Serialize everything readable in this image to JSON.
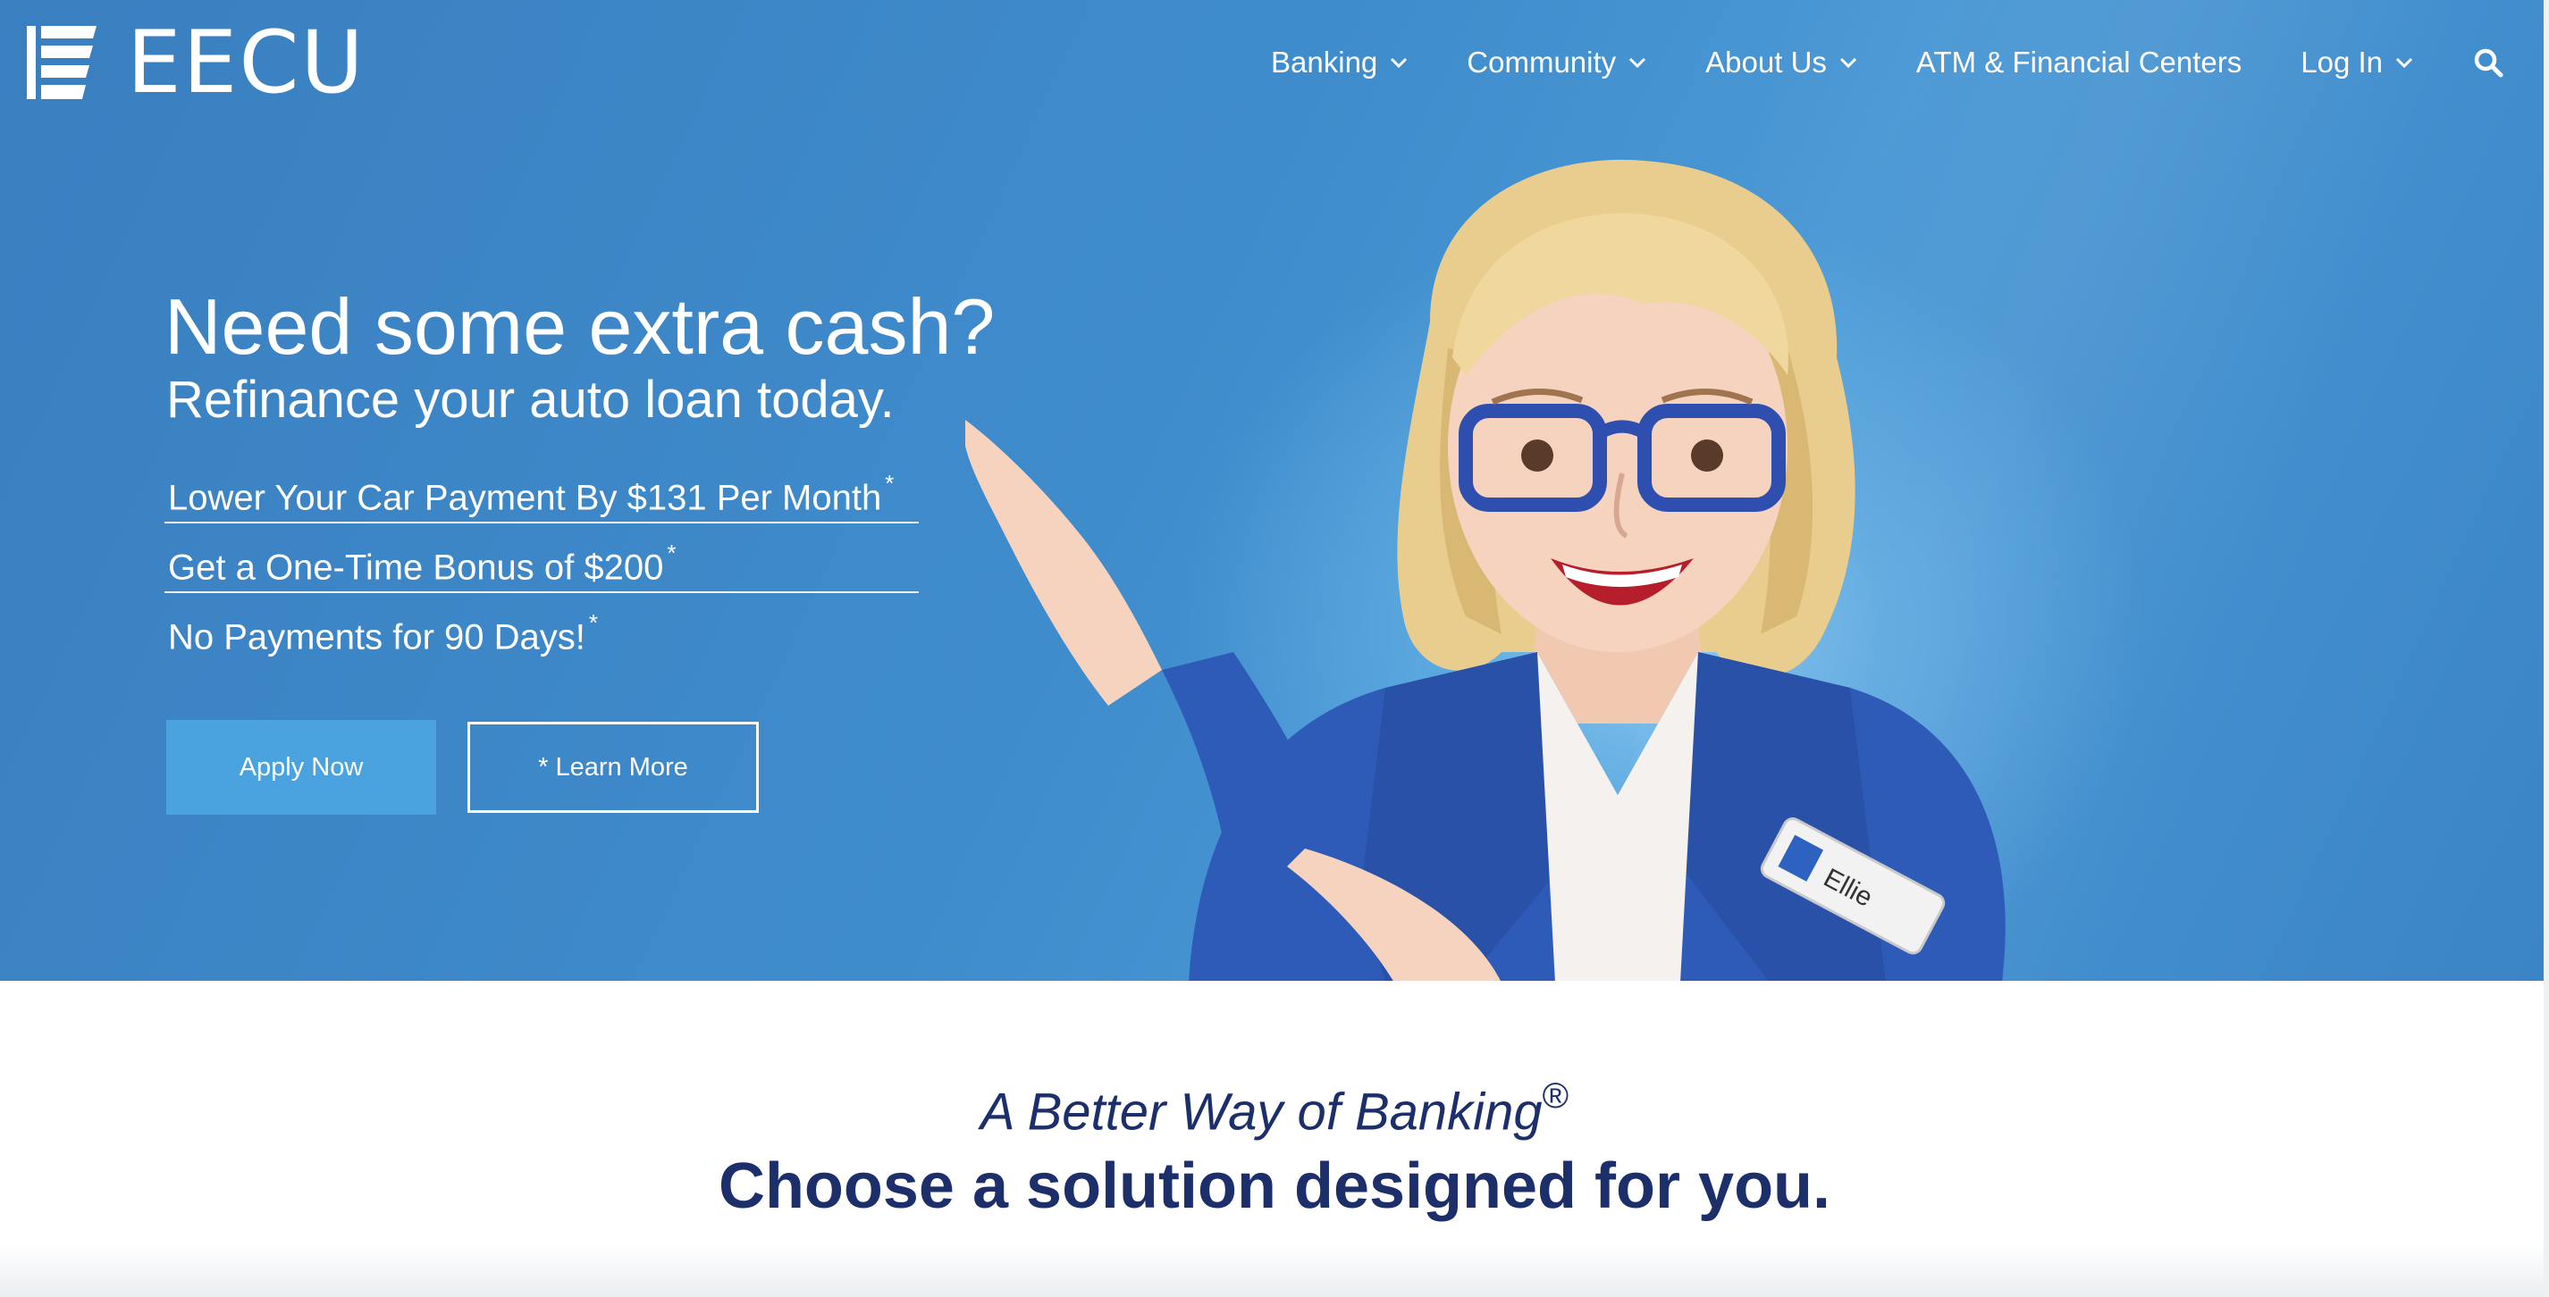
{
  "brand": {
    "name": "EECU",
    "logo_icon": "eecu-logo-mark",
    "primary_blue": "#3f8ccc",
    "navy": "#1d2f6b",
    "button_blue": "#4aa3df"
  },
  "nav": {
    "items": [
      {
        "label": "Banking",
        "has_dropdown": true
      },
      {
        "label": "Community",
        "has_dropdown": true
      },
      {
        "label": "About Us",
        "has_dropdown": true
      },
      {
        "label": "ATM & Financial Centers",
        "has_dropdown": false
      },
      {
        "label": "Log In",
        "has_dropdown": true
      }
    ],
    "search_icon": "search-icon"
  },
  "hero": {
    "headline": "Need some extra cash?",
    "subheadline": "Refinance your auto loan today.",
    "benefits": [
      {
        "text": "Lower Your Car Payment By $131 Per Month",
        "mark": "*"
      },
      {
        "text": "Get a One-Time Bonus of $200",
        "mark": "*"
      },
      {
        "text": "No Payments for 90 Days!",
        "mark": "*"
      }
    ],
    "apply_label": "Apply Now",
    "learn_label": "* Learn More",
    "name_tag": "Ellie"
  },
  "section": {
    "tagline": "A Better Way of Banking",
    "tagline_mark": "®",
    "title": "Choose a solution designed for you."
  }
}
